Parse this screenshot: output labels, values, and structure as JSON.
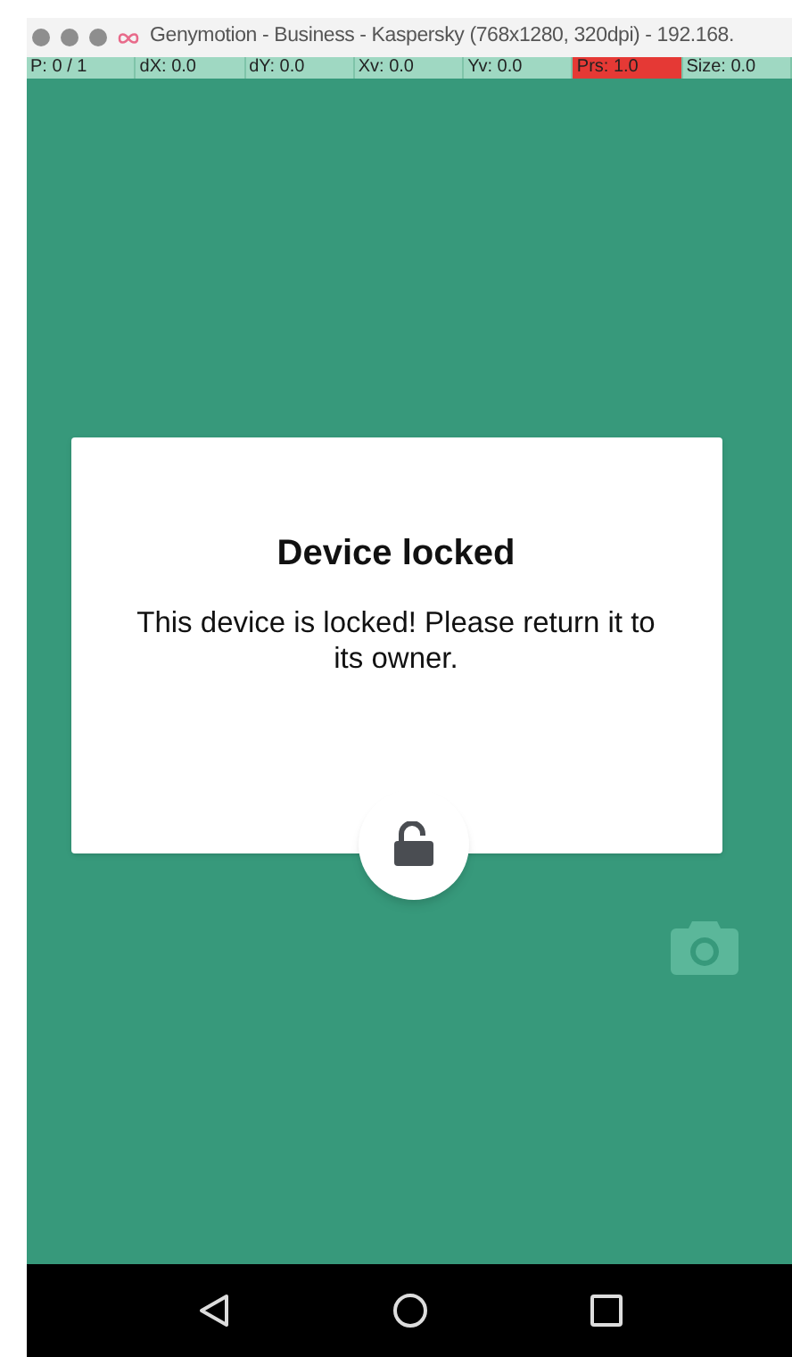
{
  "window": {
    "title": "Genymotion - Business - Kaspersky (768x1280, 320dpi) - 192.168."
  },
  "pointer_stats": [
    {
      "label": "P: 0 / 1",
      "highlighted": false
    },
    {
      "label": "dX: 0.0",
      "highlighted": false
    },
    {
      "label": "dY: 0.0",
      "highlighted": false
    },
    {
      "label": "Xv: 0.0",
      "highlighted": false
    },
    {
      "label": "Yv: 0.0",
      "highlighted": false
    },
    {
      "label": "Prs: 1.0",
      "highlighted": true
    },
    {
      "label": "Size: 0.0",
      "highlighted": false
    }
  ],
  "dialog": {
    "title": "Device locked",
    "message": "This device is locked! Please return it to its owner."
  }
}
